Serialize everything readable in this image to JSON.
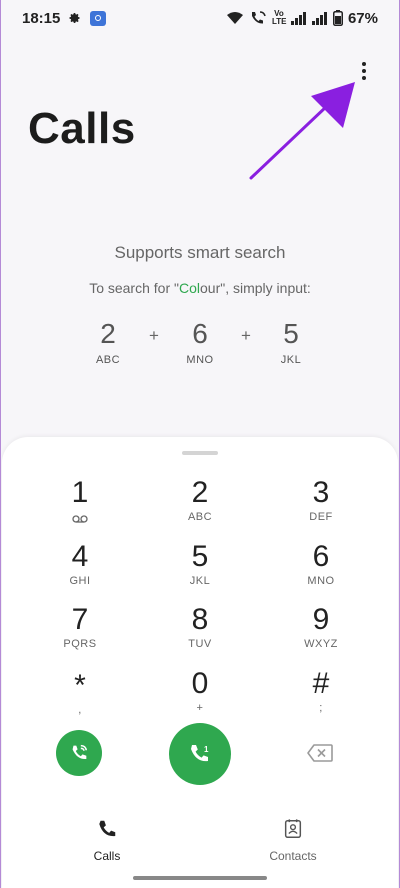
{
  "status_bar": {
    "time": "18:15",
    "battery": "67%",
    "volte": "Vo LTE",
    "icons": [
      "gear-icon",
      "cast-icon",
      "wifi-icon",
      "wifi-calling-icon",
      "signal-icon",
      "battery-icon"
    ]
  },
  "header": {
    "title": "Calls",
    "menu_icon": "more-vert-icon"
  },
  "smart_search": {
    "title": "Supports smart search",
    "hint_prefix": "To search for \"",
    "hint_word_a": "Col",
    "hint_word_b": "our",
    "hint_suffix": "\", simply input:",
    "example": [
      {
        "digit": "2",
        "letters": "ABC"
      },
      {
        "digit": "6",
        "letters": "MNO"
      },
      {
        "digit": "5",
        "letters": "JKL"
      }
    ],
    "plus": "+"
  },
  "dialpad": {
    "keys": [
      {
        "digit": "1",
        "letters": ""
      },
      {
        "digit": "2",
        "letters": "ABC"
      },
      {
        "digit": "3",
        "letters": "DEF"
      },
      {
        "digit": "4",
        "letters": "GHI"
      },
      {
        "digit": "5",
        "letters": "JKL"
      },
      {
        "digit": "6",
        "letters": "MNO"
      },
      {
        "digit": "7",
        "letters": "PQRS"
      },
      {
        "digit": "8",
        "letters": "TUV"
      },
      {
        "digit": "9",
        "letters": "WXYZ"
      },
      {
        "digit": "*",
        "letters": ","
      },
      {
        "digit": "0",
        "letters": "+"
      },
      {
        "digit": "#",
        "letters": ";"
      }
    ],
    "call_sim": "1"
  },
  "bottom_nav": {
    "calls": "Calls",
    "contacts": "Contacts"
  },
  "colors": {
    "accent_green": "#2fa84f",
    "annotation_arrow": "#8a1fe0"
  }
}
